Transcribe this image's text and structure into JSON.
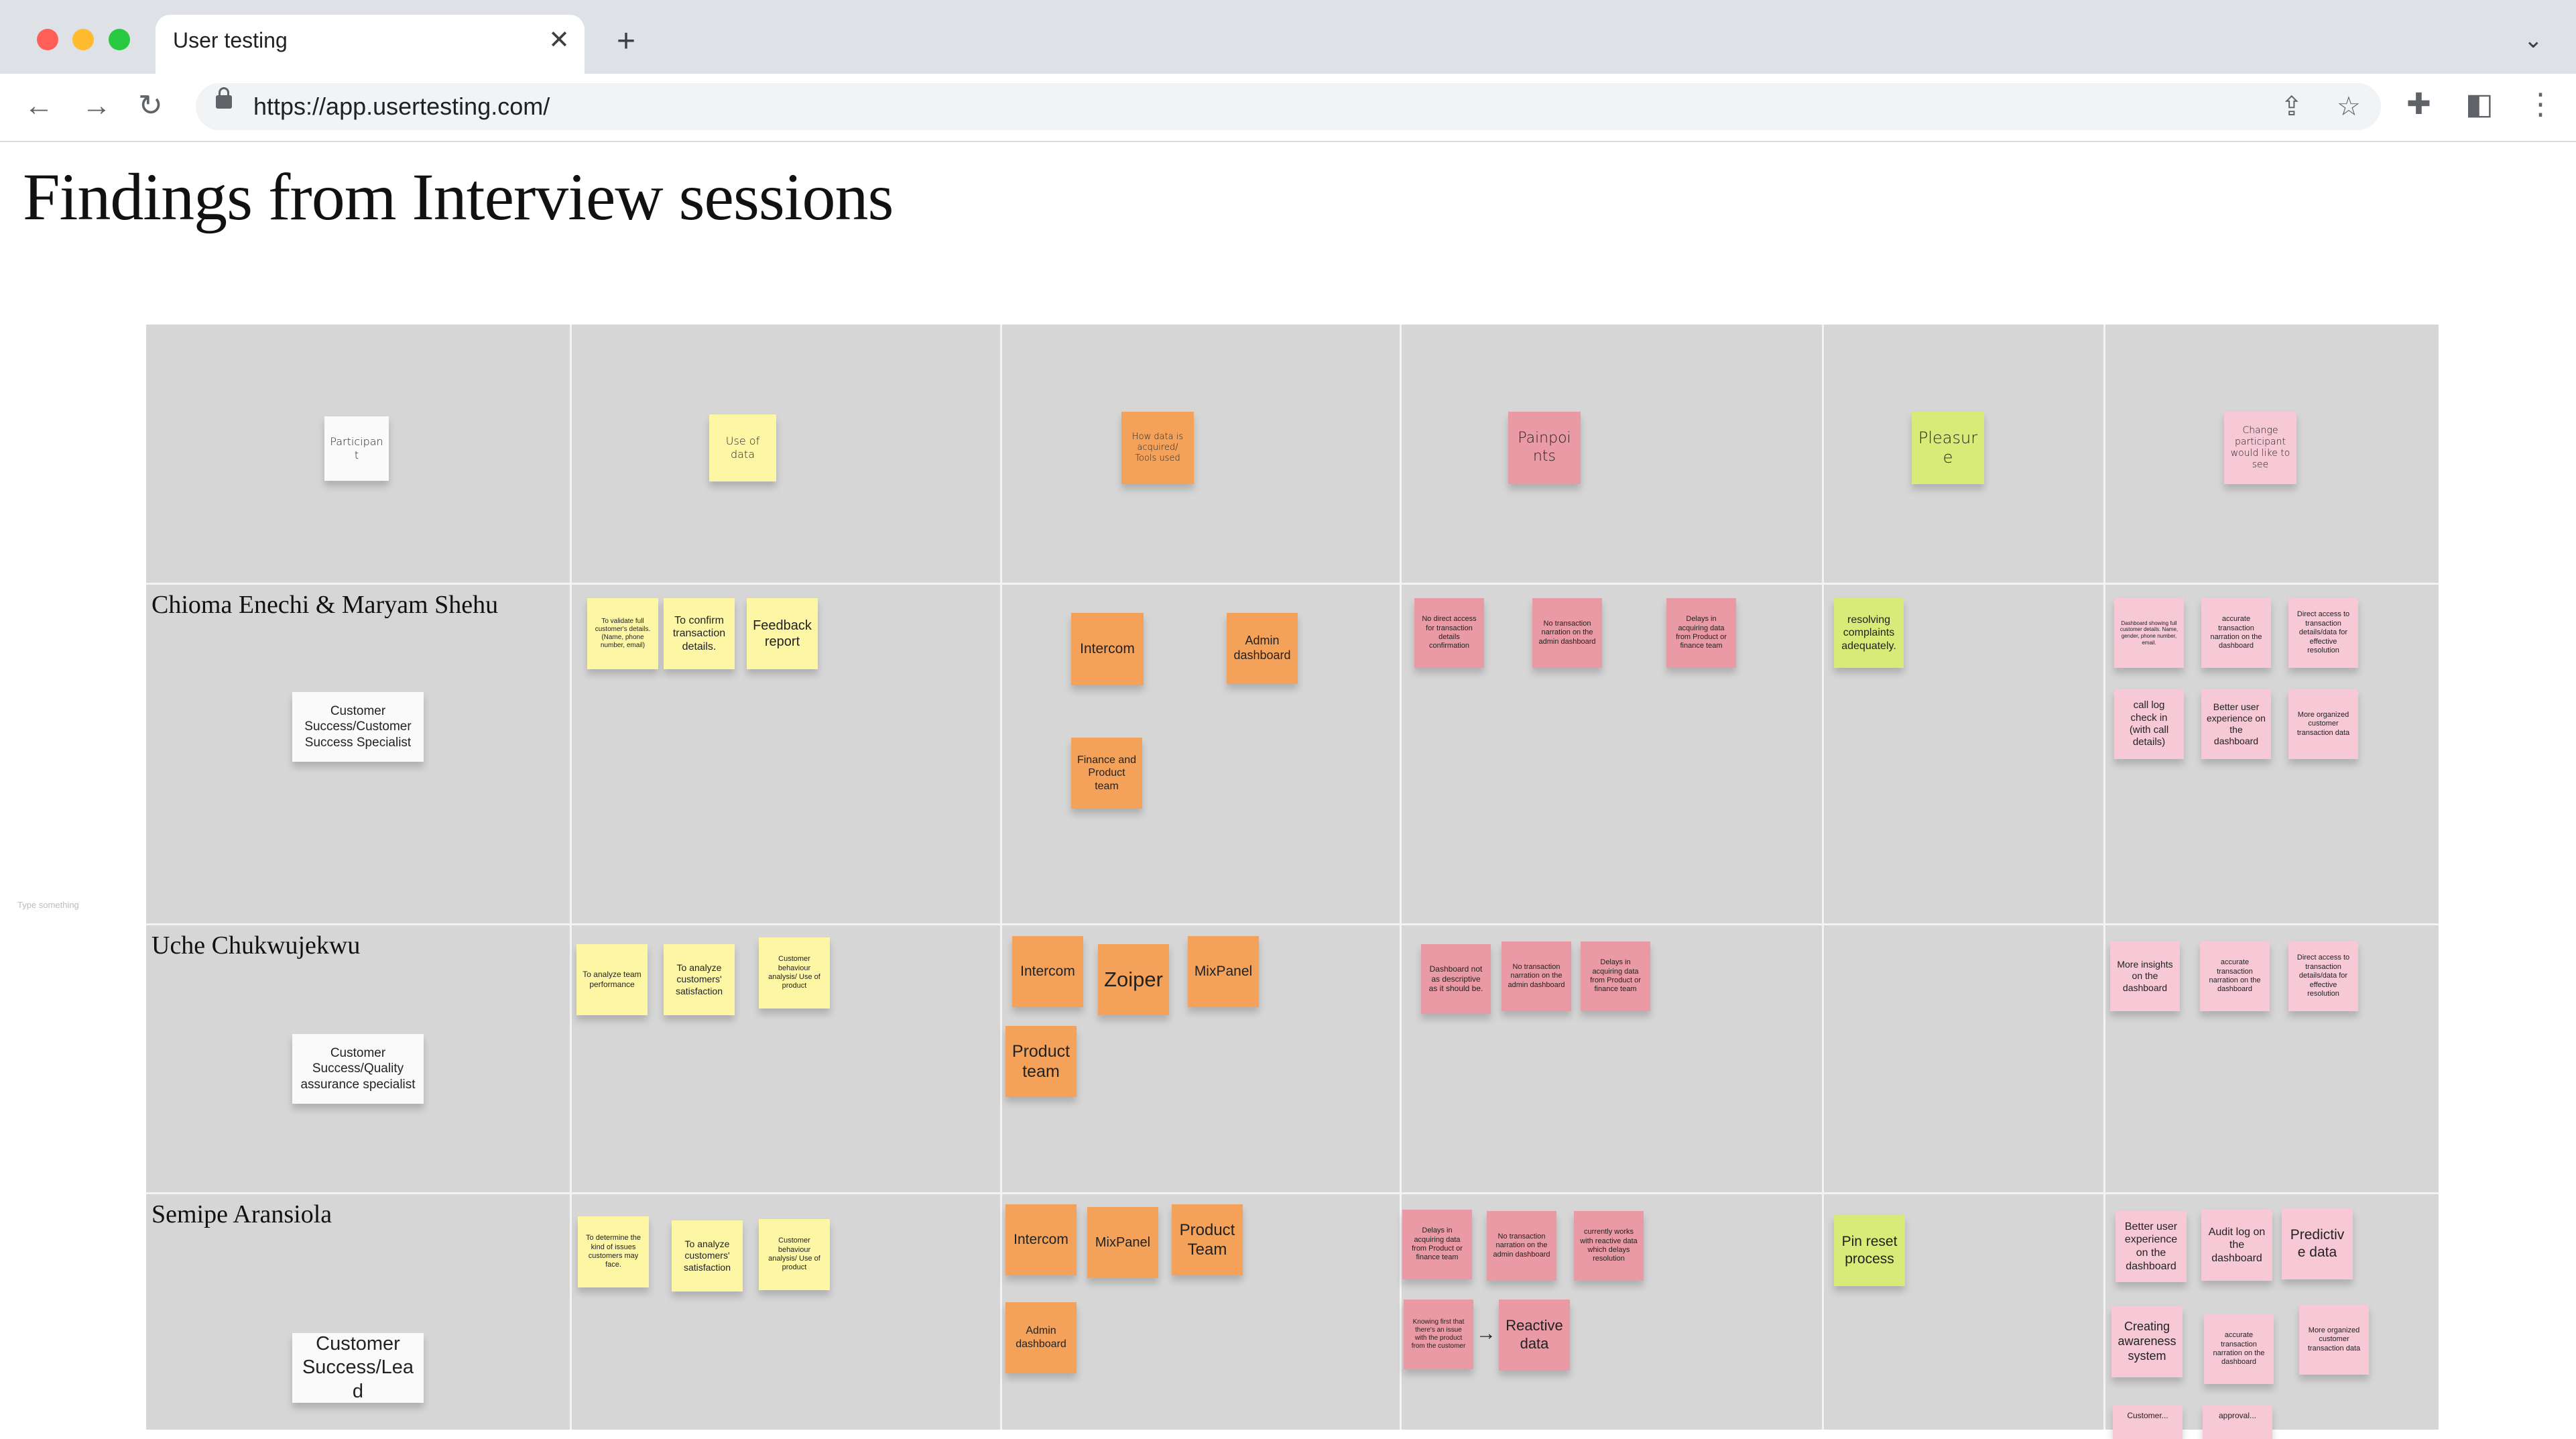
{
  "browser": {
    "tab_title": "User testing",
    "tab_close": "✕",
    "new_tab": "+",
    "url": "https://app.usertesting.com/"
  },
  "page": {
    "title": "Findings from Interview sessions"
  },
  "header_notes": {
    "participant": "Participant",
    "use_of_data": "Use of data",
    "how_data": "How data is acquired/ Tools used",
    "painpoints": "Painpoints",
    "pleasure": "Pleasure",
    "change": "Change participant would like to see"
  },
  "participants": [
    {
      "name": "Chioma Enechi & Maryam Shehu",
      "role": "Customer Success/Customer Success Specialist"
    },
    {
      "name": "Uche Chukwujekwu",
      "role": "Customer Success/Quality assurance specialist"
    },
    {
      "name": "Semipe Aransiola",
      "role": "Customer Success/Lead"
    }
  ],
  "row1": {
    "use": [
      "To validate full customer's details. (Name, phone number, email)",
      "To confirm transaction details.",
      "Feedback report"
    ],
    "tools": [
      "Intercom",
      "Admin dashboard",
      "Finance and Product team"
    ],
    "pain": [
      "No direct access for transaction details confirmation",
      "No transaction narration on the admin dashboard",
      "Delays in acquiring data from Product or finance team"
    ],
    "pleasure": [
      "resolving complaints adequately."
    ],
    "change": [
      "Dashboard showing full customer details. Name, gender, phone number, email.",
      "accurate transaction narration on the dashboard",
      "Direct access to transaction details/data for effective resolution",
      "call log check in (with call details)",
      "Better user experience on the dashboard",
      "More organized customer transaction data"
    ]
  },
  "row2": {
    "use": [
      "To analyze team performance",
      "To analyze customers' satisfaction",
      "Customer behaviour analysis/ Use of product"
    ],
    "tools": [
      "Intercom",
      "Zoiper",
      "MixPanel",
      "Product team"
    ],
    "pain": [
      "Dashboard not as descriptive as it should be.",
      "No transaction narration on the admin dashboard",
      "Delays in acquiring data from Product or finance team"
    ],
    "change": [
      "More insights on the dashboard",
      "accurate transaction narration on the dashboard",
      "Direct access to transaction details/data for effective resolution"
    ]
  },
  "row3": {
    "use": [
      "To determine the kind of issues customers may face.",
      "To analyze customers' satisfaction",
      "Customer behaviour analysis/ Use of product"
    ],
    "tools": [
      "Intercom",
      "MixPanel",
      "Product Team",
      "Admin dashboard"
    ],
    "pain": [
      "Delays in acquiring data from Product or finance team",
      "No transaction narration on the admin dashboard",
      "currently works with reactive data which delays resolution",
      "Knowing first that there's an issue with the product from the customer",
      "Reactive data"
    ],
    "pleasure": [
      "Pin reset process"
    ],
    "change": [
      "Better user experience on the dashboard",
      "Audit log on the dashboard",
      "Predictive data",
      "Creating awareness system",
      "accurate transaction narration on the dashboard",
      "More organized customer transaction data",
      "Customer...",
      "approval..."
    ]
  },
  "canvas_hint": "Type something",
  "colors": {
    "board": "#d6d6d6",
    "sticky_yellow": "#fdf7a5",
    "sticky_orange": "#f4a259",
    "sticky_red": "#e99aa4",
    "sticky_green": "#d8ea77",
    "sticky_pink": "#f7c9d7",
    "sticky_white": "#fafafa"
  }
}
